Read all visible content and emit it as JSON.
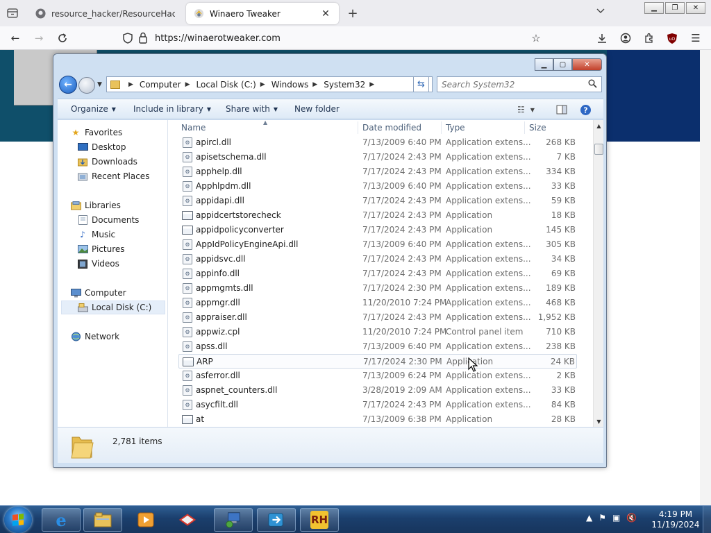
{
  "browser": {
    "tabs": [
      {
        "title": "resource_hacker/ResourceHac",
        "active": false
      },
      {
        "title": "Winaero Tweaker",
        "active": true
      }
    ],
    "url": "https://winaerotweaker.com"
  },
  "explorer": {
    "breadcrumb": [
      "Computer",
      "Local Disk (C:)",
      "Windows",
      "System32"
    ],
    "search_placeholder": "Search System32",
    "toolbar": {
      "organize": "Organize",
      "include_in_library": "Include in library",
      "share_with": "Share with",
      "new_folder": "New folder"
    },
    "nav": {
      "favorites": {
        "label": "Favorites",
        "items": [
          "Desktop",
          "Downloads",
          "Recent Places"
        ]
      },
      "libraries": {
        "label": "Libraries",
        "items": [
          "Documents",
          "Music",
          "Pictures",
          "Videos"
        ]
      },
      "computer": {
        "label": "Computer",
        "items": [
          "Local Disk (C:)"
        ]
      },
      "network": {
        "label": "Network"
      }
    },
    "columns": {
      "name": "Name",
      "date": "Date modified",
      "type": "Type",
      "size": "Size"
    },
    "files": [
      {
        "name": "apircl.dll",
        "date": "7/13/2009 6:40 PM",
        "type": "Application extens...",
        "size": "268 KB",
        "icon": "dll"
      },
      {
        "name": "apisetschema.dll",
        "date": "7/17/2024 2:43 PM",
        "type": "Application extens...",
        "size": "7 KB",
        "icon": "dll"
      },
      {
        "name": "apphelp.dll",
        "date": "7/17/2024 2:43 PM",
        "type": "Application extens...",
        "size": "334 KB",
        "icon": "dll"
      },
      {
        "name": "Apphlpdm.dll",
        "date": "7/13/2009 6:40 PM",
        "type": "Application extens...",
        "size": "33 KB",
        "icon": "dll"
      },
      {
        "name": "appidapi.dll",
        "date": "7/17/2024 2:43 PM",
        "type": "Application extens...",
        "size": "59 KB",
        "icon": "dll"
      },
      {
        "name": "appidcertstorecheck",
        "date": "7/17/2024 2:43 PM",
        "type": "Application",
        "size": "18 KB",
        "icon": "app"
      },
      {
        "name": "appidpolicyconverter",
        "date": "7/17/2024 2:43 PM",
        "type": "Application",
        "size": "145 KB",
        "icon": "app"
      },
      {
        "name": "AppIdPolicyEngineApi.dll",
        "date": "7/13/2009 6:40 PM",
        "type": "Application extens...",
        "size": "305 KB",
        "icon": "dll"
      },
      {
        "name": "appidsvc.dll",
        "date": "7/17/2024 2:43 PM",
        "type": "Application extens...",
        "size": "34 KB",
        "icon": "dll"
      },
      {
        "name": "appinfo.dll",
        "date": "7/17/2024 2:43 PM",
        "type": "Application extens...",
        "size": "69 KB",
        "icon": "dll"
      },
      {
        "name": "appmgmts.dll",
        "date": "7/17/2024 2:30 PM",
        "type": "Application extens...",
        "size": "189 KB",
        "icon": "dll"
      },
      {
        "name": "appmgr.dll",
        "date": "11/20/2010 7:24 PM",
        "type": "Application extens...",
        "size": "468 KB",
        "icon": "dll"
      },
      {
        "name": "appraiser.dll",
        "date": "7/17/2024 2:43 PM",
        "type": "Application extens...",
        "size": "1,952 KB",
        "icon": "dll"
      },
      {
        "name": "appwiz.cpl",
        "date": "11/20/2010 7:24 PM",
        "type": "Control panel item",
        "size": "710 KB",
        "icon": "dll"
      },
      {
        "name": "apss.dll",
        "date": "7/13/2009 6:40 PM",
        "type": "Application extens...",
        "size": "238 KB",
        "icon": "dll"
      },
      {
        "name": "ARP",
        "date": "7/17/2024 2:30 PM",
        "type": "Application",
        "size": "24 KB",
        "icon": "app"
      },
      {
        "name": "asferror.dll",
        "date": "7/13/2009 6:24 PM",
        "type": "Application extens...",
        "size": "2 KB",
        "icon": "dll"
      },
      {
        "name": "aspnet_counters.dll",
        "date": "3/28/2019 2:09 AM",
        "type": "Application extens...",
        "size": "33 KB",
        "icon": "dll"
      },
      {
        "name": "asycfilt.dll",
        "date": "7/17/2024 2:43 PM",
        "type": "Application extens...",
        "size": "84 KB",
        "icon": "dll"
      },
      {
        "name": "at",
        "date": "7/13/2009 6:38 PM",
        "type": "Application",
        "size": "28 KB",
        "icon": "app"
      }
    ],
    "hovered_file": "ARP",
    "status": {
      "items_count": "2,781 items"
    }
  },
  "taskbar": {
    "clock_time": "4:19 PM",
    "clock_date": "11/19/2024",
    "pinned": [
      "internet-explorer",
      "windows-explorer",
      "media-player",
      "mail-app",
      "network-app",
      "remote-app",
      "resource-hacker"
    ],
    "rh_label": "RH"
  }
}
